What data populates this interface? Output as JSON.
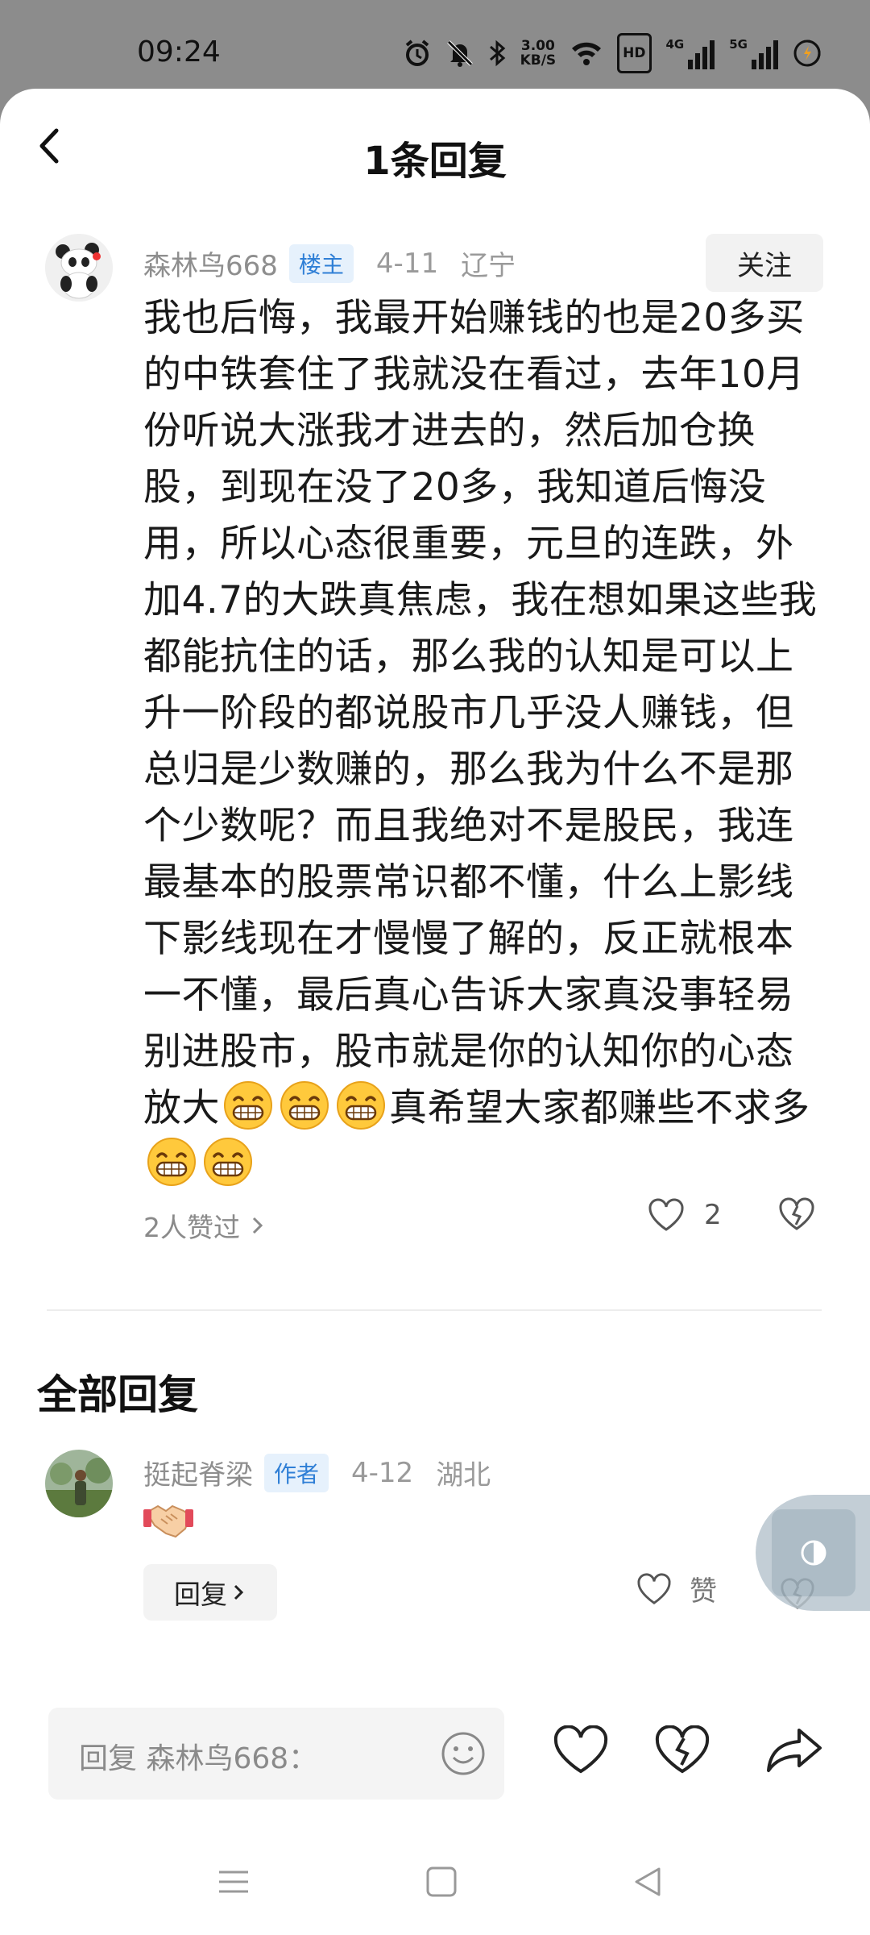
{
  "status_bar": {
    "time": "09:24",
    "net_speed_value": "3.00",
    "net_speed_unit": "KB/S",
    "hd_label": "HD",
    "signal1_label": "4G",
    "signal2_label": "5G"
  },
  "header": {
    "title": "1条回复"
  },
  "main_comment": {
    "author": "森林鸟668",
    "badge": "楼主",
    "date": "4-11",
    "region": "辽宁",
    "follow_label": "关注",
    "text_before_emoji": "我也后悔，我最开始赚钱的也是20多买的中铁套住了我就没在看过，去年10月份听说大涨我才进去的，然后加仓换股，到现在没了20多，我知道后悔没用，所以心态很重要，元旦的连跌，外加4.7的大跌真焦虑，我在想如果这些我都能抗住的话，那么我的认知是可以上升一阶段的都说股市几乎没人赚钱，但总归是少数赚的，那么我为什么不是那个少数呢？而且我绝对不是股民，我连最基本的股票常识都不懂，什么上影线下影线现在才慢慢了解的，反正就根本一不懂，最后真心告诉大家真没事轻易别进股市，股市就是你的认知你的心态放大",
    "text_middle": "真希望大家都赚些不求多",
    "likers_label": "2人赞过",
    "like_count": "2"
  },
  "replies_section": {
    "title": "全部回复"
  },
  "reply": {
    "author": "挺起脊梁",
    "badge": "作者",
    "date": "4-12",
    "region": "湖北",
    "reply_button_label": "回复",
    "like_label": "赞"
  },
  "bottom_bar": {
    "input_placeholder": "回复 森林鸟668："
  },
  "colors": {
    "badge_bg": "#e6f1fc",
    "badge_text": "#2f7fd6",
    "status_bg": "#8c8c8c"
  }
}
